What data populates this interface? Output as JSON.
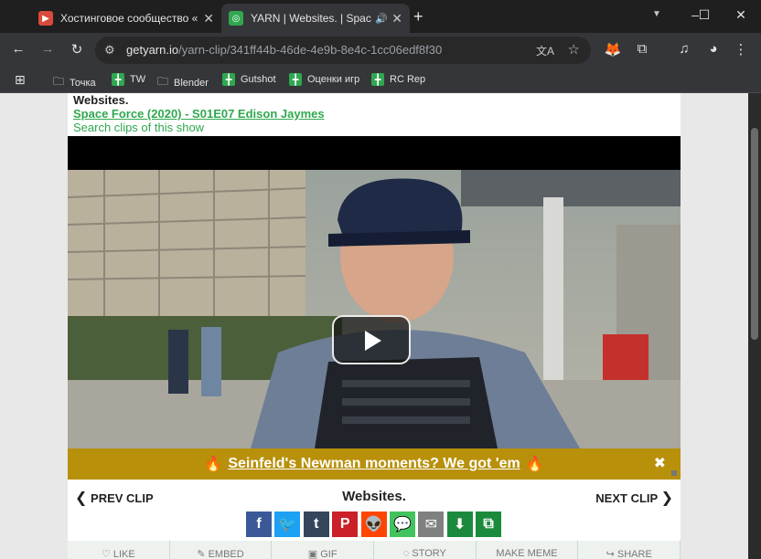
{
  "browser": {
    "tabs": [
      {
        "title": "Хостинговое сообщество «Tim",
        "favicon_color": "#d94a3a",
        "active": false
      },
      {
        "title": "YARN | Websites. | Space Fo",
        "favicon_color": "#2fa84f",
        "active": true
      }
    ],
    "url": {
      "host": "getyarn.io",
      "path": "/yarn-clip/341ff44b-46de-4e9b-8e4c-1cc06edf8f30"
    },
    "bookmarks": [
      {
        "label": "Точка",
        "type": "folder"
      },
      {
        "label": "TW",
        "type": "green"
      },
      {
        "label": "Blender",
        "type": "folder"
      },
      {
        "label": "Gutshot",
        "type": "green"
      },
      {
        "label": "Оценки игр",
        "type": "green"
      },
      {
        "label": "RC Rep",
        "type": "green"
      }
    ]
  },
  "page": {
    "quote": "Websites.",
    "show_link": "Space Force (2020) - S01E07 Edison Jaymes",
    "search_clips": "Search clips of this show",
    "promo": {
      "text": "Seinfeld's Newman moments? We got 'em",
      "emoji": "🔥",
      "close": "✖"
    },
    "nav": {
      "prev": "PREV CLIP",
      "title": "Websites.",
      "next": "NEXT CLIP"
    },
    "share_icons": [
      {
        "name": "facebook-icon",
        "glyph": "f",
        "color": "#3b5998"
      },
      {
        "name": "twitter-icon",
        "glyph": "🐦",
        "color": "#1da1f2"
      },
      {
        "name": "tumblr-icon",
        "glyph": "t",
        "color": "#35465c"
      },
      {
        "name": "pinterest-icon",
        "glyph": "P",
        "color": "#cb2027"
      },
      {
        "name": "reddit-icon",
        "glyph": "👽",
        "color": "#ff4500"
      },
      {
        "name": "message-icon",
        "glyph": "💬",
        "color": "#43c35e"
      },
      {
        "name": "email-icon",
        "glyph": "✉",
        "color": "#808080"
      },
      {
        "name": "download-icon",
        "glyph": "⬇",
        "color": "#1c8a3d"
      },
      {
        "name": "copy-icon",
        "glyph": "⧉",
        "color": "#1c8a3d"
      }
    ],
    "actions": [
      "♡ LIKE",
      "✎ EMBED",
      "▣ GIF",
      "◌ STORY",
      "MAKE MEME",
      "↪ SHARE"
    ]
  }
}
